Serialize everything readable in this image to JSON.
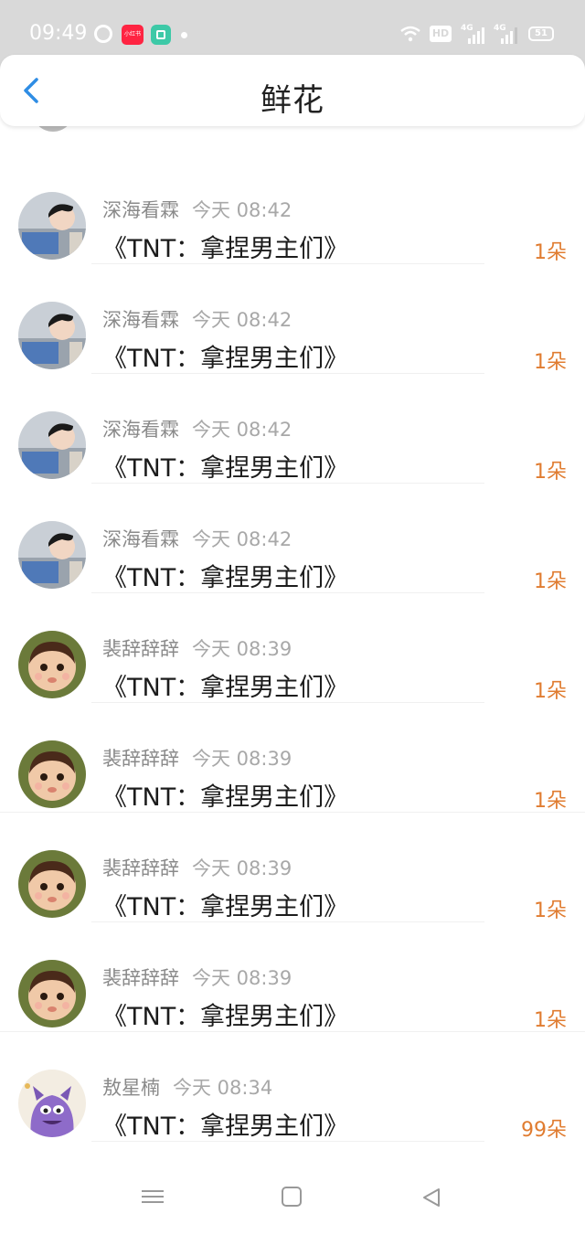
{
  "status_bar": {
    "time": "09:49",
    "xhs_label": "小红书",
    "hd": "HD",
    "signal1": "4G",
    "signal2": "4G",
    "battery": "51"
  },
  "header": {
    "title": "鲜花",
    "back_icon": "chevron-left-icon",
    "accent_color": "#2f8de4"
  },
  "records": [
    {
      "name": "深海看霖",
      "time": "今天 08:42",
      "book": "《TNT：拿捏男主们》",
      "count": "1朵",
      "avatar": "boy"
    },
    {
      "name": "深海看霖",
      "time": "今天 08:42",
      "book": "《TNT：拿捏男主们》",
      "count": "1朵",
      "avatar": "boy"
    },
    {
      "name": "深海看霖",
      "time": "今天 08:42",
      "book": "《TNT：拿捏男主们》",
      "count": "1朵",
      "avatar": "boy"
    },
    {
      "name": "深海看霖",
      "time": "今天 08:42",
      "book": "《TNT：拿捏男主们》",
      "count": "1朵",
      "avatar": "boy"
    },
    {
      "name": "裴辞辞辞",
      "time": "今天 08:39",
      "book": "《TNT：拿捏男主们》",
      "count": "1朵",
      "avatar": "girl"
    },
    {
      "name": "裴辞辞辞",
      "time": "今天 08:39",
      "book": "《TNT：拿捏男主们》",
      "count": "1朵",
      "avatar": "girl"
    },
    {
      "name": "裴辞辞辞",
      "time": "今天 08:39",
      "book": "《TNT：拿捏男主们》",
      "count": "1朵",
      "avatar": "girl"
    },
    {
      "name": "裴辞辞辞",
      "time": "今天 08:39",
      "book": "《TNT：拿捏男主们》",
      "count": "1朵",
      "avatar": "girl"
    },
    {
      "name": "敖星楠",
      "time": "今天 08:34",
      "book": "《TNT：拿捏男主们》",
      "count": "99朵",
      "avatar": "monster"
    }
  ],
  "colors": {
    "count": "#e07c30",
    "meta": "#8a8a8a",
    "status_bar_bg": "#d9d9d9"
  },
  "navbar": {
    "menu_icon": "menu-icon",
    "home_icon": "home-square-icon",
    "back_icon": "back-triangle-icon"
  }
}
